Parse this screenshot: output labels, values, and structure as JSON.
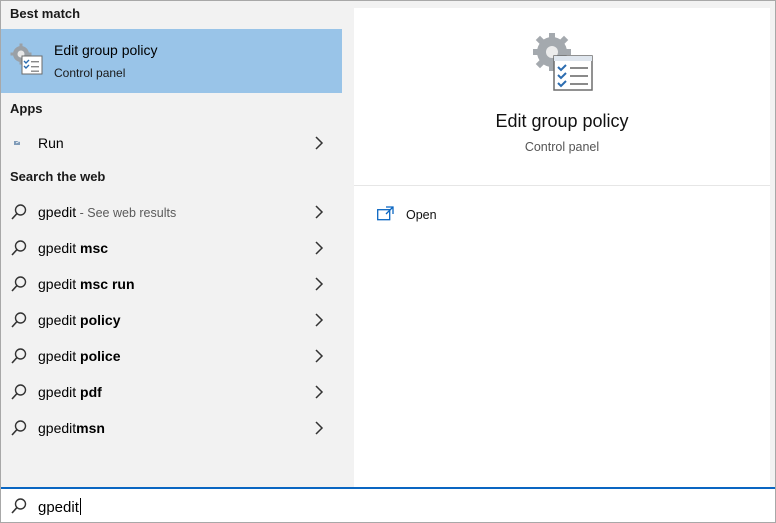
{
  "left": {
    "best_match_label": "Best match",
    "best_match": {
      "title": "Edit group policy",
      "subtitle": "Control panel",
      "icon": "group-policy-icon"
    },
    "apps_label": "Apps",
    "apps": [
      {
        "label": "Run",
        "icon": "run-icon"
      }
    ],
    "web_label": "Search the web",
    "web_results": [
      {
        "prefix": "gpedit",
        "bold": "",
        "hint": " - See web results"
      },
      {
        "prefix": "gpedit ",
        "bold": "msc",
        "hint": ""
      },
      {
        "prefix": "gpedit ",
        "bold": "msc run",
        "hint": ""
      },
      {
        "prefix": "gpedit ",
        "bold": "policy",
        "hint": ""
      },
      {
        "prefix": "gpedit ",
        "bold": "police",
        "hint": ""
      },
      {
        "prefix": "gpedit ",
        "bold": "pdf",
        "hint": ""
      },
      {
        "prefix": "gpedit",
        "bold": "msn",
        "hint": ""
      }
    ]
  },
  "right": {
    "title": "Edit group policy",
    "subtitle": "Control panel",
    "actions": [
      {
        "label": "Open",
        "icon": "open-window-icon"
      }
    ]
  },
  "search": {
    "query": "gpedit",
    "icon": "search-icon"
  },
  "colors": {
    "highlight": "#99c4e8",
    "accent": "#0a66c2",
    "pane_bg": "#f2f2f2"
  }
}
